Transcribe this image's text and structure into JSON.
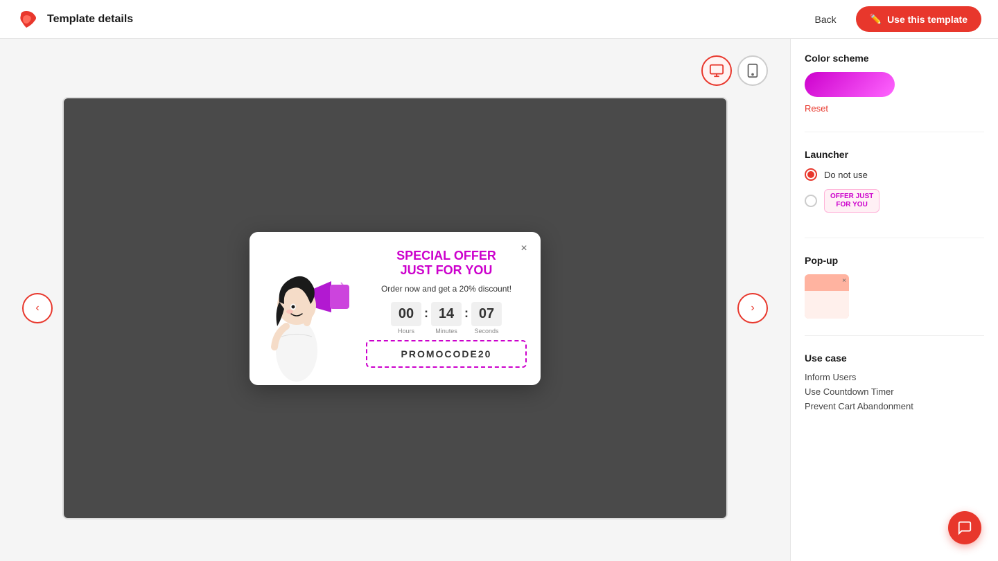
{
  "header": {
    "title": "Template details",
    "back_label": "Back",
    "use_template_label": "Use this template"
  },
  "device_toggles": {
    "desktop_label": "🖥",
    "mobile_label": "📱"
  },
  "nav": {
    "prev_label": "‹",
    "next_label": "›"
  },
  "popup": {
    "close_label": "×",
    "title_line1": "SPECIAL OFFER",
    "title_line2": "JUST FOR YOU",
    "subtitle": "Order now and get a 20% discount!",
    "countdown": {
      "hours": "00",
      "minutes": "14",
      "seconds": "07",
      "hours_label": "Hours",
      "minutes_label": "Minutes",
      "seconds_label": "Seconds",
      "sep1": ":",
      "sep2": ":"
    },
    "promo_code": "PROMOCODE20"
  },
  "sidebar": {
    "color_scheme_title": "Color scheme",
    "reset_label": "Reset",
    "launcher_title": "Launcher",
    "launcher_options": [
      {
        "id": "do-not-use",
        "label": "Do not use",
        "checked": true
      },
      {
        "id": "badge",
        "label": "",
        "checked": false
      }
    ],
    "launcher_badge_text": "OFFER JUST\nFOR YOU",
    "popup_title": "Pop-up",
    "use_case_title": "Use case",
    "use_case_items": [
      "Inform Users",
      "Use Countdown Timer",
      "Prevent Cart Abandonment"
    ]
  },
  "chat_icon": "💬"
}
